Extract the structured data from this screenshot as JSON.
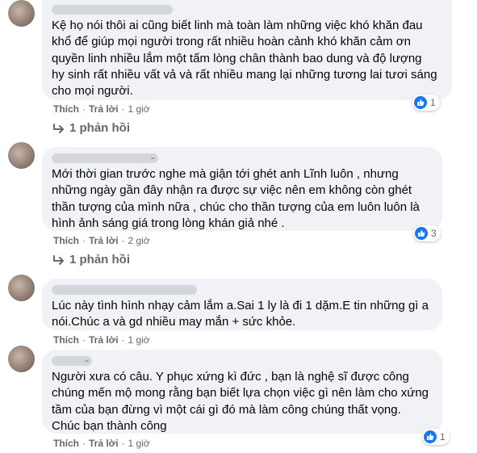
{
  "comments": [
    {
      "text": "Kệ họ nói thôi ai cũng biết linh mà toàn làm những việc khó khăn đau\nkhổ để giúp mọi người trong rất nhiều hoàn cảnh khó khăn cảm ơn\nquyền linh nhiều lắm một tấm lòng chân thành bao dung và độ lượng\nhy sinh rất nhiều vất vả và rất nhiều mang lại những tương lai tươi sáng\ncho mọi người.",
      "like_label": "Thích",
      "reply_label": "Trả lời",
      "time": "1 giờ",
      "reaction_count": "1",
      "replies_label": "1 phản hồi"
    },
    {
      "name_suffix": "~",
      "text": "Mới thời gian trước nghe mà giận tới ghét anh Lĩnh luôn , nhưng\nnhững ngày gần đây nhận ra được sự việc nên em không còn ghét\nthần tượng của mình nữa , chúc cho thần tượng của em luôn luôn là\nhình ảnh sáng giá trong lòng khán giả nhé .",
      "like_label": "Thích",
      "reply_label": "Trả lời",
      "time": "2 giờ",
      "reaction_count": "3",
      "replies_label": "1 phản hồi"
    },
    {
      "text": "Lúc này tình hình nhạy cảm lắm a.Sai 1 ly là đi 1 dặm.E tin những gì a\nnói.Chúc a và gd nhiều may mắn + sức khỏe.",
      "like_label": "Thích",
      "reply_label": "Trả lời",
      "time": "1 giờ"
    },
    {
      "name_suffix": "~",
      "text": "Người xưa có câu. Y phục xứng kì đức , bạn là nghệ sĩ được công\nchúng mến mộ mong rằng bạn biết lựa chọn việc gì nên làm cho xứng\ntầm của bạn đừng vì một cái gì đó mà làm công chúng thất vọng.\nChúc bạn thành công",
      "like_label": "Thích",
      "reply_label": "Trả lời",
      "time": "1 giờ",
      "reaction_count": "1"
    }
  ]
}
